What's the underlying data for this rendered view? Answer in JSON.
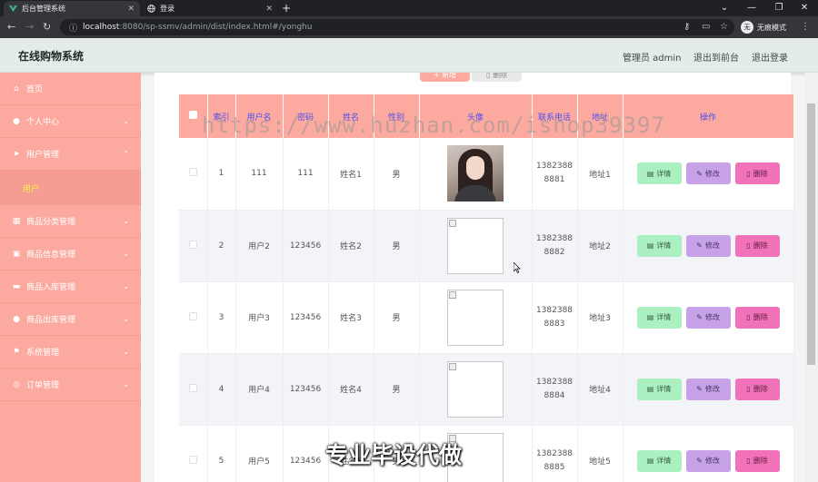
{
  "browser": {
    "tabs": [
      {
        "title": "后台管理系统",
        "active": true
      },
      {
        "title": "登录",
        "active": false
      }
    ],
    "url_host": "localhost",
    "url_path": ":8080/sp-ssmv/admin/dist/index.html#/yonghu",
    "profile_label": "无痕模式",
    "profile_initial": "无"
  },
  "header": {
    "brand": "在线购物系统",
    "links": [
      "管理员 admin",
      "退出到前台",
      "退出登录"
    ]
  },
  "sidebar": {
    "items": [
      {
        "label": "首页",
        "icon": "home-icon",
        "glyph": "⌂",
        "has_chevron": false
      },
      {
        "label": "个人中心",
        "icon": "user-icon",
        "glyph": "●",
        "has_chevron": true
      },
      {
        "label": "用户管理",
        "icon": "send-icon",
        "glyph": "➤",
        "has_chevron": true,
        "expanded": true
      },
      {
        "label": "商品分类管理",
        "icon": "grid-icon",
        "glyph": "▦",
        "has_chevron": true
      },
      {
        "label": "商品信息管理",
        "icon": "clipboard-icon",
        "glyph": "▣",
        "has_chevron": true
      },
      {
        "label": "商品入库管理",
        "icon": "ticket-icon",
        "glyph": "▬",
        "has_chevron": true
      },
      {
        "label": "商品出库管理",
        "icon": "user-icon",
        "glyph": "●",
        "has_chevron": true
      },
      {
        "label": "系统管理",
        "icon": "flag-icon",
        "glyph": "⚑",
        "has_chevron": true
      },
      {
        "label": "订单管理",
        "icon": "compass-icon",
        "glyph": "◎",
        "has_chevron": true
      }
    ],
    "sub_item": "用户"
  },
  "toolbar": {
    "add_label": "新增",
    "delete_label": "删除"
  },
  "table": {
    "headers": [
      "",
      "索引",
      "用户名",
      "密码",
      "姓名",
      "性别",
      "头像",
      "联系电话",
      "地址",
      "操作"
    ],
    "rows": [
      {
        "index": "1",
        "username": "111",
        "password": "111",
        "name": "姓名1",
        "gender": "男",
        "phone_a": "1382388",
        "phone_b": "8881",
        "address": "地址1",
        "avatar": "photo"
      },
      {
        "index": "2",
        "username": "用户2",
        "password": "123456",
        "name": "姓名2",
        "gender": "男",
        "phone_a": "1382388",
        "phone_b": "8882",
        "address": "地址2",
        "avatar": "broken"
      },
      {
        "index": "3",
        "username": "用户3",
        "password": "123456",
        "name": "姓名3",
        "gender": "男",
        "phone_a": "1382388",
        "phone_b": "8883",
        "address": "地址3",
        "avatar": "broken"
      },
      {
        "index": "4",
        "username": "用户4",
        "password": "123456",
        "name": "姓名4",
        "gender": "男",
        "phone_a": "1382388",
        "phone_b": "8884",
        "address": "地址4",
        "avatar": "broken"
      },
      {
        "index": "5",
        "username": "用户5",
        "password": "123456",
        "name": "姓名5",
        "gender": "男",
        "phone_a": "1382388",
        "phone_b": "8885",
        "address": "地址5",
        "avatar": "broken"
      }
    ],
    "actions": {
      "detail": "详情",
      "edit": "修改",
      "delete": "删除"
    }
  },
  "overlay": {
    "watermark": "https://www.huzhan.com/ishop39397",
    "banner": "专业毕设代做"
  },
  "colors": {
    "sidebar_bg": "#fcaaa0",
    "header_bg": "#e4ecea",
    "th_text": "#4e4ef0",
    "detail_btn": "#aaf0c0",
    "edit_btn": "#c7a2e8",
    "delete_btn": "#f272ba",
    "submenu_text": "#fcf24a"
  }
}
